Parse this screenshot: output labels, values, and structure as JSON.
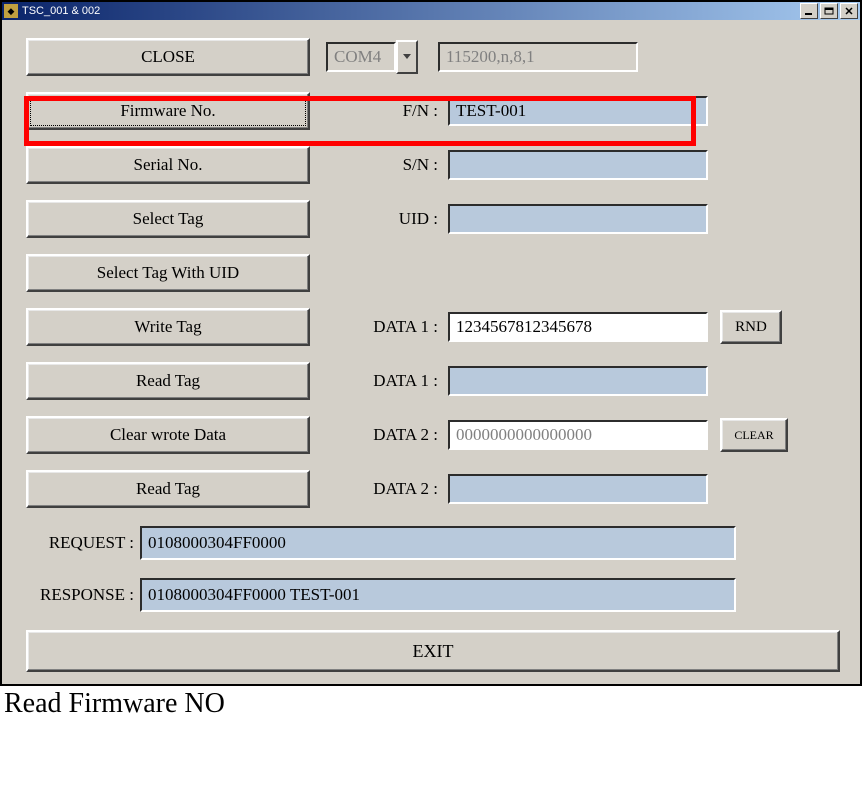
{
  "window": {
    "title": "TSC_001 & 002"
  },
  "buttons": {
    "close": "CLOSE",
    "firmware_no": "Firmware No.",
    "serial_no": "Serial No.",
    "select_tag": "Select Tag",
    "select_tag_uid": "Select Tag With UID",
    "write_tag": "Write Tag",
    "read_tag_1": "Read Tag",
    "clear_wrote": "Clear wrote Data",
    "read_tag_2": "Read Tag",
    "rnd": "RND",
    "clear": "CLEAR",
    "exit": "EXIT"
  },
  "labels": {
    "fn": "F/N :",
    "sn": "S/N :",
    "uid": "UID :",
    "data1_in": "DATA 1 :",
    "data1_out": "DATA 1 :",
    "data2_in": "DATA 2 :",
    "data2_out": "DATA 2 :",
    "request": "REQUEST :",
    "response": "RESPONSE :"
  },
  "fields": {
    "com_port": "COM4",
    "serial_params": "115200,n,8,1",
    "fn_value": "TEST-001",
    "sn_value": "",
    "uid_value": "",
    "data1_input": "1234567812345678",
    "data1_output": "",
    "data2_input_placeholder": "0000000000000000",
    "data2_output": "",
    "request": "0108000304FF0000",
    "response": "0108000304FF0000  TEST-001"
  },
  "caption": "Read Firmware NO"
}
